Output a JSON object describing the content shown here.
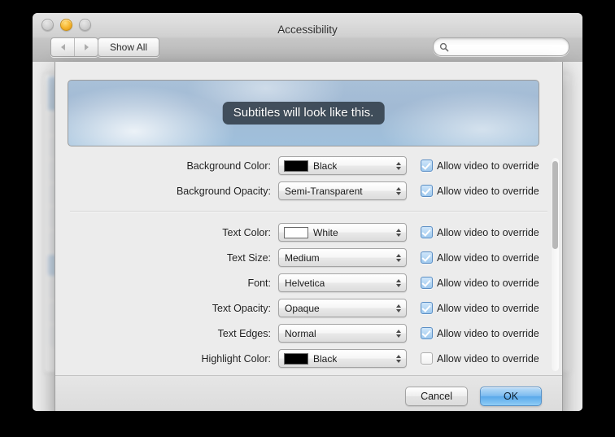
{
  "window": {
    "title": "Accessibility",
    "traffic_lights": [
      "close-button",
      "minimize-button",
      "zoom-button"
    ],
    "toolbar": {
      "back_label": "",
      "forward_label": "",
      "show_all_label": "Show All",
      "search_placeholder": "",
      "search_value": ""
    },
    "help_label": "?"
  },
  "sheet": {
    "preview": {
      "subtitle_text": "Subtitles will look like this."
    },
    "override_label": "Allow video to override",
    "rows": [
      {
        "label": "Background Color:",
        "value": "Black",
        "swatch": "#000000",
        "override": true
      },
      {
        "label": "Background Opacity:",
        "value": "Semi-Transparent",
        "swatch": null,
        "override": true
      },
      {
        "label": "Text Color:",
        "value": "White",
        "swatch": "#ffffff",
        "override": true
      },
      {
        "label": "Text Size:",
        "value": "Medium",
        "swatch": null,
        "override": true
      },
      {
        "label": "Font:",
        "value": "Helvetica",
        "swatch": null,
        "override": true
      },
      {
        "label": "Text Opacity:",
        "value": "Opaque",
        "swatch": null,
        "override": true
      },
      {
        "label": "Text Edges:",
        "value": "Normal",
        "swatch": null,
        "override": true
      },
      {
        "label": "Highlight Color:",
        "value": "Black",
        "swatch": "#000000",
        "override": false
      }
    ],
    "divider_after_row_index": 1,
    "footer": {
      "cancel_label": "Cancel",
      "ok_label": "OK"
    }
  },
  "colors": {
    "accent_blue": "#7dbcf0",
    "sheet_bg": "#ececec",
    "preview_sky": "#a2bad4",
    "subtitle_chip": "#2e3a46"
  }
}
